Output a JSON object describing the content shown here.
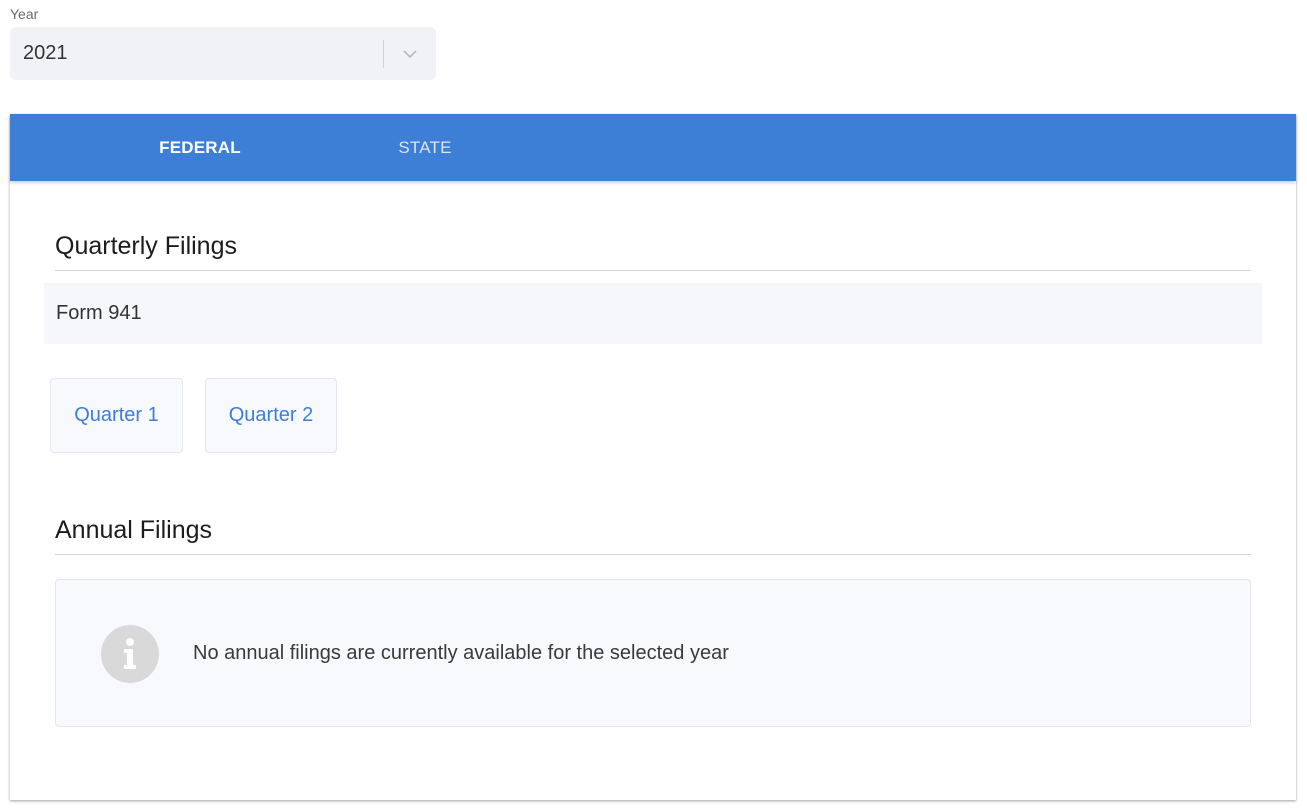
{
  "year_selector": {
    "label": "Year",
    "value": "2021",
    "chevron_icon": "chevron-down-icon"
  },
  "tabs": [
    {
      "label": "FEDERAL",
      "active": true
    },
    {
      "label": "STATE",
      "active": false
    }
  ],
  "colors": {
    "accent": "#3d7ed6",
    "tab_active_text": "#ffffff",
    "link": "#3d7ed6"
  },
  "quarterly": {
    "title": "Quarterly Filings",
    "form_name": "Form 941",
    "quarters": [
      "Quarter 1",
      "Quarter 2"
    ]
  },
  "annual": {
    "title": "Annual Filings",
    "empty_message": "No annual filings are currently available for the selected year",
    "info_icon": "info-icon"
  }
}
